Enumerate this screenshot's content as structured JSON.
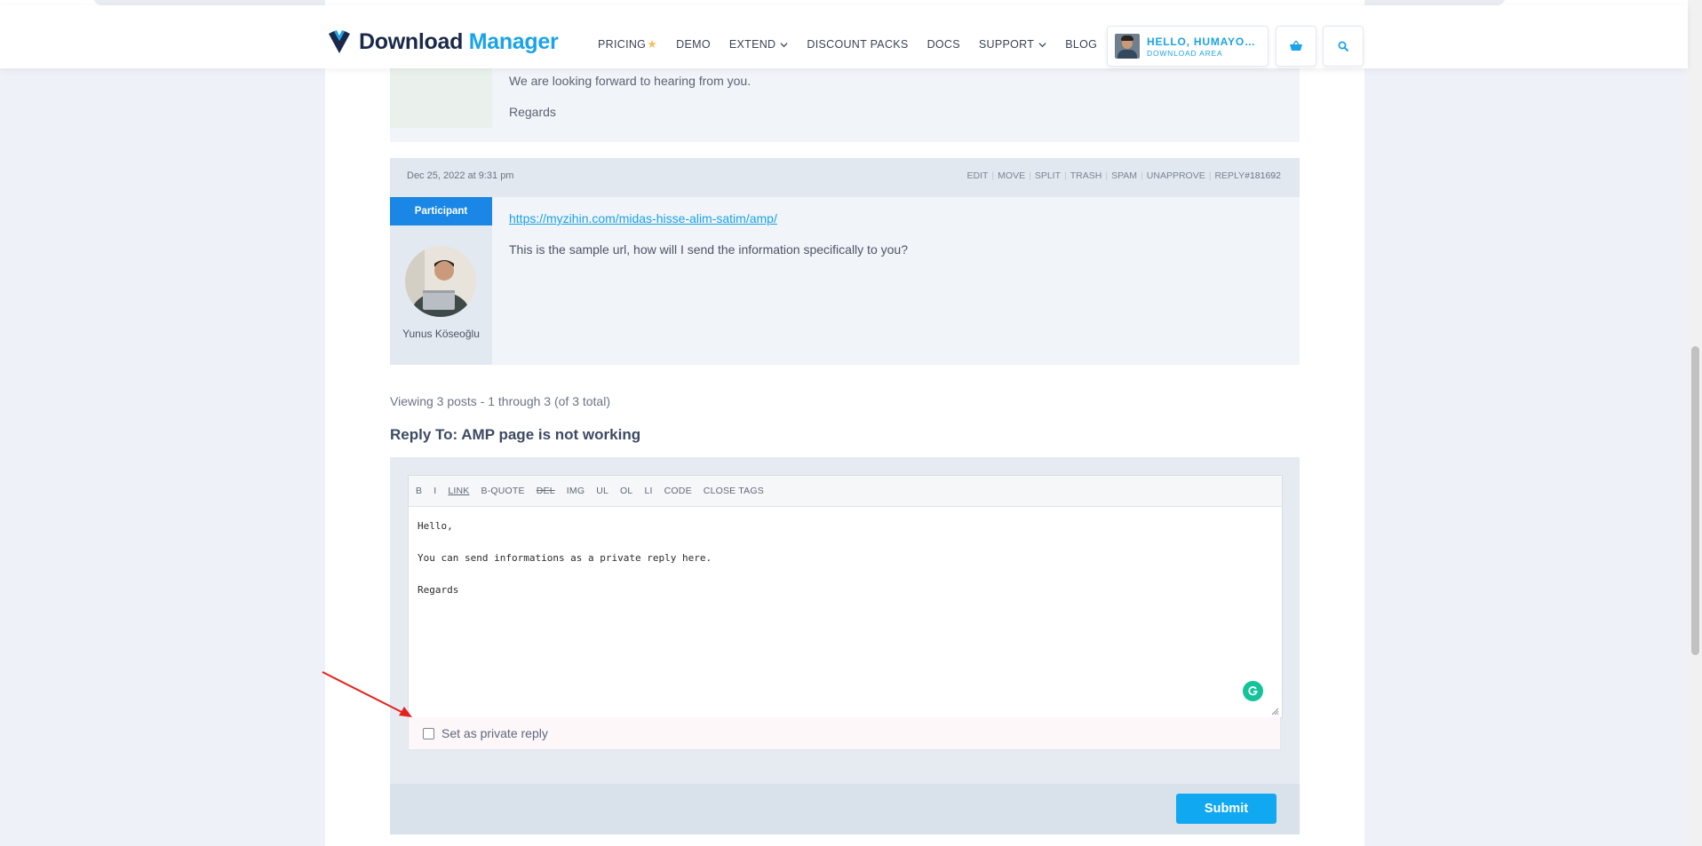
{
  "header": {
    "logo": {
      "word1": "Download",
      "word2": "Manager"
    },
    "nav": [
      {
        "label": "PRICING",
        "star": "★"
      },
      {
        "label": "DEMO"
      },
      {
        "label": "EXTEND"
      },
      {
        "label": "DISCOUNT PACKS"
      },
      {
        "label": "DOCS"
      },
      {
        "label": "SUPPORT"
      },
      {
        "label": "BLOG"
      }
    ],
    "user": {
      "greeting": "HELLO, HUMAYON KABIR",
      "subtitle": "DOWNLOAD AREA"
    },
    "cart_icon": "basket-icon",
    "search_icon": "search-icon"
  },
  "previous_post": {
    "lines": [
      "We are looking forward to hearing from you.",
      "Regards"
    ]
  },
  "reply": {
    "date": "Dec 25, 2022 at 9:31 pm",
    "admin_links": [
      "EDIT",
      "MOVE",
      "SPLIT",
      "TRASH",
      "SPAM",
      "UNAPPROVE",
      "REPLY"
    ],
    "reply_id": "#181692",
    "role": "Participant",
    "author_name": "Yunus Köseoğlu",
    "link": "https://myzihin.com/midas-hisse-alim-satim/amp/",
    "text": "This is the sample url, how will I send the information specifically to you?"
  },
  "pagination": {
    "summary": "Viewing 3 posts - 1 through 3 (of 3 total)"
  },
  "reply_form": {
    "title": "Reply To: AMP page is not working",
    "toolbar": [
      "B",
      "I",
      "LINK",
      "B-QUOTE",
      "DEL",
      "IMG",
      "UL",
      "OL",
      "LI",
      "CODE",
      "CLOSE TAGS"
    ],
    "content": "Hello,\n\nYou can send informations as a private reply here.\n\nRegards",
    "private_label": "Set as private reply",
    "private_checked": false,
    "submit_label": "Submit"
  },
  "colors": {
    "brand_dark": "#1b2a4a",
    "brand_blue": "#1aa3e8",
    "participant_badge": "#1a87e6",
    "submit": "#10a8f0",
    "annotation_arrow": "#e5211d"
  }
}
